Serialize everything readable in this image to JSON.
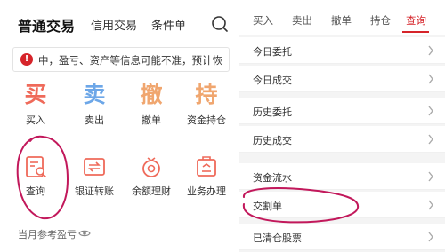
{
  "left": {
    "tabs": [
      {
        "label": "普通交易"
      },
      {
        "label": "信用交易"
      },
      {
        "label": "条件单"
      }
    ],
    "notice": {
      "icon_text": "!",
      "text": "中，盈亏、资产等信息可能不准，预计恢"
    },
    "grid": [
      {
        "glyph": "买",
        "label": "买入",
        "icon": "buy-glyph"
      },
      {
        "glyph": "卖",
        "label": "卖出",
        "icon": "sell-glyph"
      },
      {
        "glyph": "撤",
        "label": "撤单",
        "icon": "cancel-glyph"
      },
      {
        "glyph": "持",
        "label": "资金持仓",
        "icon": "hold-glyph"
      },
      {
        "label": "查询",
        "icon": "query-icon"
      },
      {
        "label": "银证转账",
        "icon": "transfer-icon"
      },
      {
        "label": "余额理财",
        "icon": "wealth-icon"
      },
      {
        "label": "业务办理",
        "icon": "business-icon"
      }
    ],
    "footer": "当月参考盈亏"
  },
  "right": {
    "tabs": [
      {
        "label": "买入"
      },
      {
        "label": "卖出"
      },
      {
        "label": "撤单"
      },
      {
        "label": "持仓"
      },
      {
        "label": "查询"
      }
    ],
    "active_tab": "查询",
    "group1": [
      "今日委托",
      "今日成交",
      "历史委托",
      "历史成交"
    ],
    "group2": [
      "资金流水",
      "交割单",
      "已清仓股票"
    ]
  },
  "colors": {
    "brand_red": "#d6242a",
    "annotation_stroke": "#c2185b",
    "glyph_red": "#ef6a5a",
    "glyph_blue": "#6da7e8",
    "glyph_orange": "#f0a66f"
  }
}
